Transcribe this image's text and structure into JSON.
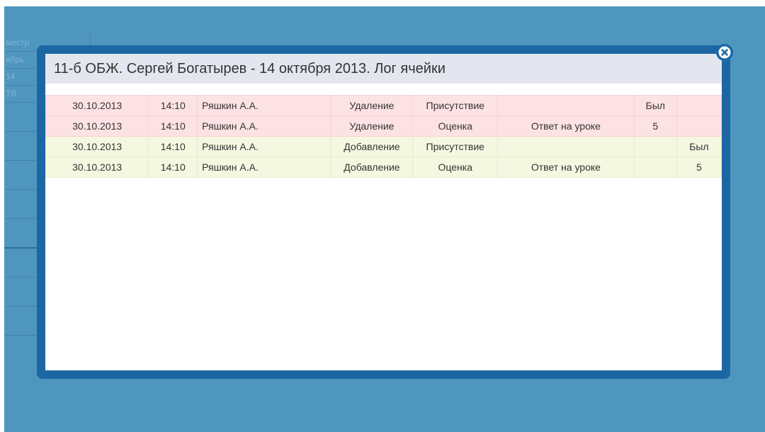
{
  "background_table": {
    "rows": [
      "местр",
      "ябрь",
      "14",
      "ТВ"
    ]
  },
  "modal": {
    "title": "11-б ОБЖ. Сергей Богатырев - 14 октября 2013. Лог ячейки",
    "rows": [
      {
        "date": "30.10.2013",
        "time": "14:10",
        "user": "Ряшкин А.А.",
        "action": "Удаление",
        "type": "Присутствие",
        "comment": "",
        "old": "Был",
        "new": "",
        "kind": "removed"
      },
      {
        "date": "30.10.2013",
        "time": "14:10",
        "user": "Ряшкин А.А.",
        "action": "Удаление",
        "type": "Оценка",
        "comment": "Ответ на уроке",
        "old": "5",
        "new": "",
        "kind": "removed"
      },
      {
        "date": "30.10.2013",
        "time": "14:10",
        "user": "Ряшкин А.А.",
        "action": "Добавление",
        "type": "Присутствие",
        "comment": "",
        "old": "",
        "new": "Был",
        "kind": "added"
      },
      {
        "date": "30.10.2013",
        "time": "14:10",
        "user": "Ряшкин А.А.",
        "action": "Добавление",
        "type": "Оценка",
        "comment": "Ответ на уроке",
        "old": "",
        "new": "5",
        "kind": "added"
      }
    ]
  },
  "colors": {
    "overlay": "#4f96bf",
    "frame": "#1c67a3",
    "title_bg": "#e3e6ee",
    "removed_row": "#fde2e4",
    "added_row": "#f4f8e1"
  },
  "icons": {
    "close": "close-circle-icon"
  }
}
